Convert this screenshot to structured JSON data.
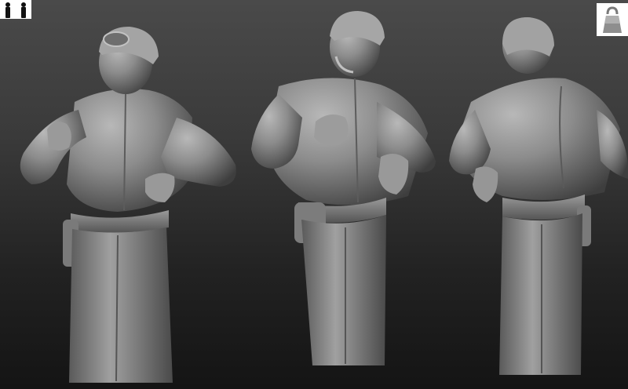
{
  "viewport": {
    "background_top": "#4a4a4a",
    "background_bottom": "#141414"
  },
  "scene": {
    "material_color": "#8a8a8a",
    "figures": [
      {
        "view": "three-quarter-left"
      },
      {
        "view": "front"
      },
      {
        "view": "back"
      }
    ]
  },
  "toolbar": {
    "left_icon": "two-figures-icon",
    "right_icon": "material-ball-icon"
  }
}
